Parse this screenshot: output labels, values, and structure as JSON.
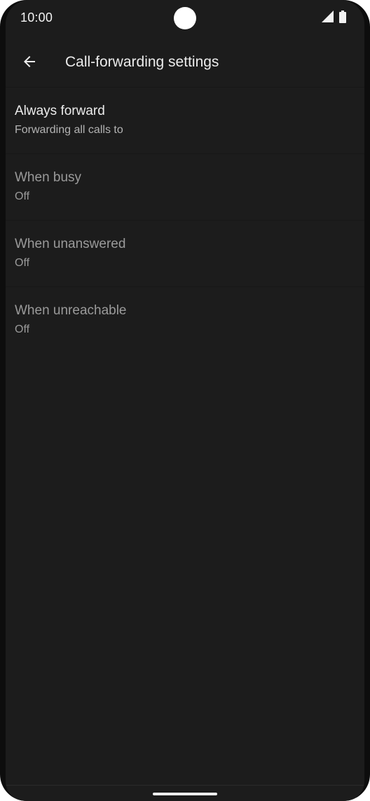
{
  "status_bar": {
    "time": "10:00",
    "icons": [
      "signal-icon",
      "battery-icon"
    ]
  },
  "app_bar": {
    "back_icon": "arrow-back-icon",
    "title": "Call-forwarding settings"
  },
  "items": [
    {
      "title": "Always forward",
      "summary": "Forwarding all calls to",
      "state": "enabled"
    },
    {
      "title": "When busy",
      "summary": "Off",
      "state": "disabled"
    },
    {
      "title": "When unanswered",
      "summary": "Off",
      "state": "disabled"
    },
    {
      "title": "When unreachable",
      "summary": "Off",
      "state": "disabled"
    }
  ],
  "colors": {
    "background": "#1c1c1c",
    "text_primary": "#ececec",
    "text_disabled": "#9a9a9a"
  }
}
